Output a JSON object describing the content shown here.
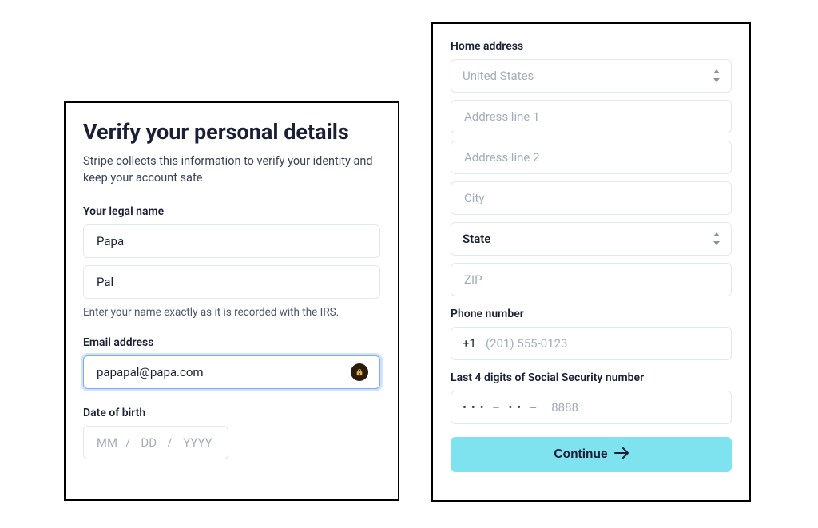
{
  "left": {
    "title": "Verify your personal details",
    "subtitle": "Stripe collects this information to verify your identity and keep your account safe.",
    "legal_name": {
      "label": "Your legal name",
      "first_value": "Papa",
      "last_value": "Pal",
      "hint": "Enter your name exactly as it is recorded with the IRS."
    },
    "email": {
      "label": "Email address",
      "value": "papapal@papa.com"
    },
    "dob": {
      "label": "Date of birth",
      "mm_placeholder": "MM",
      "dd_placeholder": "DD",
      "yyyy_placeholder": "YYYY",
      "sep": "/"
    }
  },
  "right": {
    "address": {
      "label": "Home address",
      "country_value": "United States",
      "line1_placeholder": "Address line 1",
      "line2_placeholder": "Address line 2",
      "city_placeholder": "City",
      "state_label": "State",
      "zip_placeholder": "ZIP"
    },
    "phone": {
      "label": "Phone number",
      "prefix": "+1",
      "placeholder": "(201) 555-0123"
    },
    "ssn": {
      "label": "Last 4 digits of Social Security number",
      "mask": "• • •  –  • •  – ",
      "placeholder": "8888"
    },
    "continue_label": "Continue"
  }
}
